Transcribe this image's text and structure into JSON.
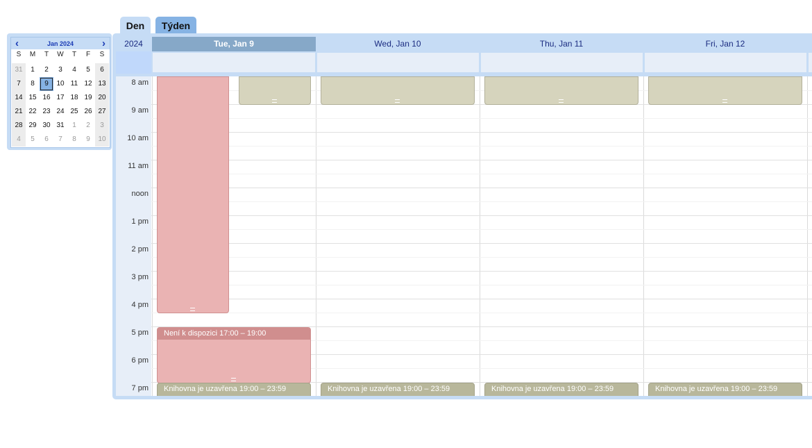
{
  "tabs": {
    "day": "Den",
    "week": "Týden"
  },
  "mini_calendar": {
    "title": "Jan 2024",
    "prev": "‹",
    "next": "›",
    "weekdays": [
      "S",
      "M",
      "T",
      "W",
      "T",
      "F",
      "S"
    ],
    "weeks": [
      [
        "31",
        "1",
        "2",
        "3",
        "4",
        "5",
        "6"
      ],
      [
        "7",
        "8",
        "9",
        "10",
        "11",
        "12",
        "13"
      ],
      [
        "14",
        "15",
        "16",
        "17",
        "18",
        "19",
        "20"
      ],
      [
        "21",
        "22",
        "23",
        "24",
        "25",
        "26",
        "27"
      ],
      [
        "28",
        "29",
        "30",
        "31",
        "1",
        "2",
        "3"
      ],
      [
        "4",
        "5",
        "6",
        "7",
        "8",
        "9",
        "10"
      ]
    ],
    "today": "9"
  },
  "calendar": {
    "year": "2024",
    "days": [
      "Tue, Jan 9",
      "Wed, Jan 10",
      "Thu, Jan 11",
      "Fri, Jan 12"
    ],
    "today_index": 0,
    "hours": [
      "8 am",
      "9 am",
      "10 am",
      "11 am",
      "noon",
      "1 pm",
      "2 pm",
      "3 pm",
      "4 pm",
      "5 pm",
      "6 pm",
      "7 pm"
    ]
  },
  "events": {
    "unavailable_title": "Není k dispozici 17:00 – 19:00",
    "closed_title": "Knihovna je uzavřena 19:00 – 23:59"
  },
  "colors": {
    "frame": "#c6dcf5",
    "today_header": "#86a8c8",
    "unavailable": "#eab3b3",
    "closed": "#d6d4bd",
    "closed_evening": "#b8b79b"
  }
}
